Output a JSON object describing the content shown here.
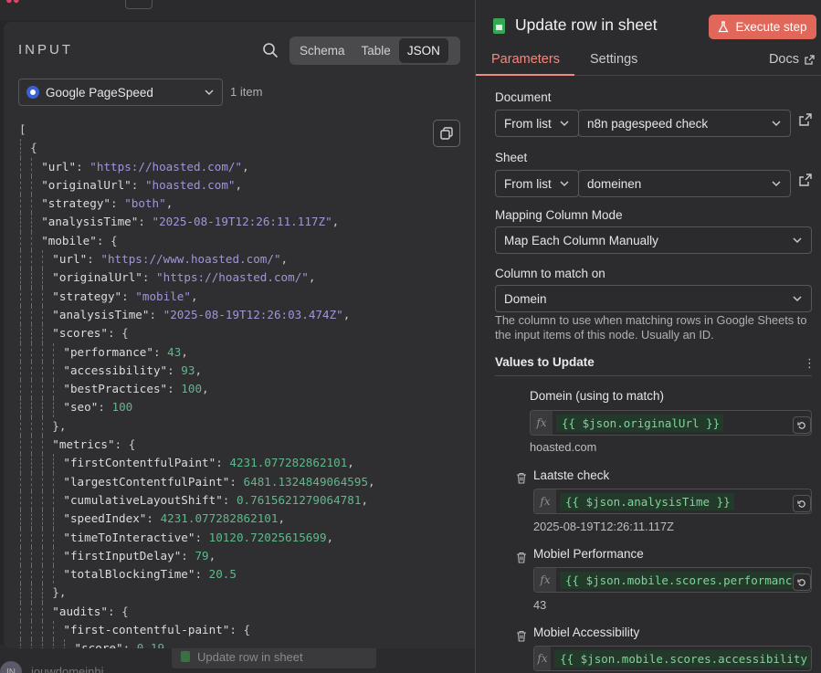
{
  "input": {
    "title": "INPUT",
    "views": [
      "Schema",
      "Table",
      "JSON"
    ],
    "active_view": "JSON",
    "source": "Google PageSpeed",
    "item_count": "1 item",
    "json_lines": [
      {
        "d": 0,
        "t": [
          [
            "p",
            "["
          ]
        ]
      },
      {
        "d": 1,
        "t": [
          [
            "p",
            "{"
          ]
        ]
      },
      {
        "d": 2,
        "t": [
          [
            "k",
            "\"url\""
          ],
          [
            "p",
            ": "
          ],
          [
            "s",
            "\"https://hoasted.com/\""
          ],
          [
            "p",
            ","
          ]
        ]
      },
      {
        "d": 2,
        "t": [
          [
            "k",
            "\"originalUrl\""
          ],
          [
            "p",
            ": "
          ],
          [
            "s",
            "\"hoasted.com\""
          ],
          [
            "p",
            ","
          ]
        ]
      },
      {
        "d": 2,
        "t": [
          [
            "k",
            "\"strategy\""
          ],
          [
            "p",
            ": "
          ],
          [
            "s",
            "\"both\""
          ],
          [
            "p",
            ","
          ]
        ]
      },
      {
        "d": 2,
        "t": [
          [
            "k",
            "\"analysisTime\""
          ],
          [
            "p",
            ": "
          ],
          [
            "s",
            "\"2025-08-19T12:26:11.117Z\""
          ],
          [
            "p",
            ","
          ]
        ]
      },
      {
        "d": 2,
        "t": [
          [
            "k",
            "\"mobile\""
          ],
          [
            "p",
            ": {"
          ]
        ]
      },
      {
        "d": 3,
        "t": [
          [
            "k",
            "\"url\""
          ],
          [
            "p",
            ": "
          ],
          [
            "s",
            "\"https://www.hoasted.com/\""
          ],
          [
            "p",
            ","
          ]
        ]
      },
      {
        "d": 3,
        "t": [
          [
            "k",
            "\"originalUrl\""
          ],
          [
            "p",
            ": "
          ],
          [
            "s",
            "\"https://hoasted.com/\""
          ],
          [
            "p",
            ","
          ]
        ]
      },
      {
        "d": 3,
        "t": [
          [
            "k",
            "\"strategy\""
          ],
          [
            "p",
            ": "
          ],
          [
            "s",
            "\"mobile\""
          ],
          [
            "p",
            ","
          ]
        ]
      },
      {
        "d": 3,
        "t": [
          [
            "k",
            "\"analysisTime\""
          ],
          [
            "p",
            ": "
          ],
          [
            "s",
            "\"2025-08-19T12:26:03.474Z\""
          ],
          [
            "p",
            ","
          ]
        ]
      },
      {
        "d": 3,
        "t": [
          [
            "k",
            "\"scores\""
          ],
          [
            "p",
            ": {"
          ]
        ]
      },
      {
        "d": 4,
        "t": [
          [
            "k",
            "\"performance\""
          ],
          [
            "p",
            ": "
          ],
          [
            "n",
            "43"
          ],
          [
            "p",
            ","
          ]
        ]
      },
      {
        "d": 4,
        "t": [
          [
            "k",
            "\"accessibility\""
          ],
          [
            "p",
            ": "
          ],
          [
            "n",
            "93"
          ],
          [
            "p",
            ","
          ]
        ]
      },
      {
        "d": 4,
        "t": [
          [
            "k",
            "\"bestPractices\""
          ],
          [
            "p",
            ": "
          ],
          [
            "n",
            "100"
          ],
          [
            "p",
            ","
          ]
        ]
      },
      {
        "d": 4,
        "t": [
          [
            "k",
            "\"seo\""
          ],
          [
            "p",
            ": "
          ],
          [
            "n",
            "100"
          ]
        ]
      },
      {
        "d": 3,
        "t": [
          [
            "p",
            "},"
          ]
        ]
      },
      {
        "d": 3,
        "t": [
          [
            "k",
            "\"metrics\""
          ],
          [
            "p",
            ": {"
          ]
        ]
      },
      {
        "d": 4,
        "t": [
          [
            "k",
            "\"firstContentfulPaint\""
          ],
          [
            "p",
            ": "
          ],
          [
            "n",
            "4231.077282862101"
          ],
          [
            "p",
            ","
          ]
        ]
      },
      {
        "d": 4,
        "t": [
          [
            "k",
            "\"largestContentfulPaint\""
          ],
          [
            "p",
            ": "
          ],
          [
            "n",
            "6481.1324849064595"
          ],
          [
            "p",
            ","
          ]
        ]
      },
      {
        "d": 4,
        "t": [
          [
            "k",
            "\"cumulativeLayoutShift\""
          ],
          [
            "p",
            ": "
          ],
          [
            "n",
            "0.7615621279064781"
          ],
          [
            "p",
            ","
          ]
        ]
      },
      {
        "d": 4,
        "t": [
          [
            "k",
            "\"speedIndex\""
          ],
          [
            "p",
            ": "
          ],
          [
            "n",
            "4231.077282862101"
          ],
          [
            "p",
            ","
          ]
        ]
      },
      {
        "d": 4,
        "t": [
          [
            "k",
            "\"timeToInteractive\""
          ],
          [
            "p",
            ": "
          ],
          [
            "n",
            "10120.72025615699"
          ],
          [
            "p",
            ","
          ]
        ]
      },
      {
        "d": 4,
        "t": [
          [
            "k",
            "\"firstInputDelay\""
          ],
          [
            "p",
            ": "
          ],
          [
            "n",
            "79"
          ],
          [
            "p",
            ","
          ]
        ]
      },
      {
        "d": 4,
        "t": [
          [
            "k",
            "\"totalBlockingTime\""
          ],
          [
            "p",
            ": "
          ],
          [
            "n",
            "20.5"
          ]
        ]
      },
      {
        "d": 3,
        "t": [
          [
            "p",
            "},"
          ]
        ]
      },
      {
        "d": 3,
        "t": [
          [
            "k",
            "\"audits\""
          ],
          [
            "p",
            ": {"
          ]
        ]
      },
      {
        "d": 4,
        "t": [
          [
            "k",
            "\"first-contentful-paint\""
          ],
          [
            "p",
            ": {"
          ]
        ]
      },
      {
        "d": 5,
        "t": [
          [
            "k",
            "\"score\""
          ],
          [
            "p",
            ": "
          ],
          [
            "n",
            "0.19"
          ]
        ]
      }
    ]
  },
  "background": {
    "node_chip": "Update row in sheet",
    "user_text": "jouwdomeinhi",
    "avatar_initials": "IN"
  },
  "node": {
    "title": "Update row in sheet",
    "execute_label": "Execute step",
    "tabs": [
      "Parameters",
      "Settings"
    ],
    "docs_label": "Docs",
    "document": {
      "label": "Document",
      "mode": "From list",
      "value": "n8n pagespeed check"
    },
    "sheet": {
      "label": "Sheet",
      "mode": "From list",
      "value": "domeinen"
    },
    "mapping_mode": {
      "label": "Mapping Column Mode",
      "value": "Map Each Column Manually"
    },
    "match_column": {
      "label": "Column to match on",
      "value": "Domein",
      "hint": "The column to use when matching rows in Google Sheets to the input items of this node. Usually an ID."
    },
    "values_heading": "Values to Update",
    "mappings": [
      {
        "label": "Domein (using to match)",
        "expr": "{{ $json.originalUrl }}",
        "preview": "hoasted.com"
      },
      {
        "label": "Laatste check",
        "expr": "{{ $json.analysisTime }}",
        "preview": "2025-08-19T12:26:11.117Z"
      },
      {
        "label": "Mobiel Performance",
        "expr": "{{ $json.mobile.scores.performance",
        "preview": "43"
      },
      {
        "label": "Mobiel Accessibility",
        "expr": "{{ $json.mobile.scores.accessibility",
        "preview": ""
      }
    ]
  },
  "colors": {
    "accent": "#f08a7e",
    "execute": "#e0675a",
    "json_string": "#9d97d8",
    "json_number": "#5fb88b"
  }
}
